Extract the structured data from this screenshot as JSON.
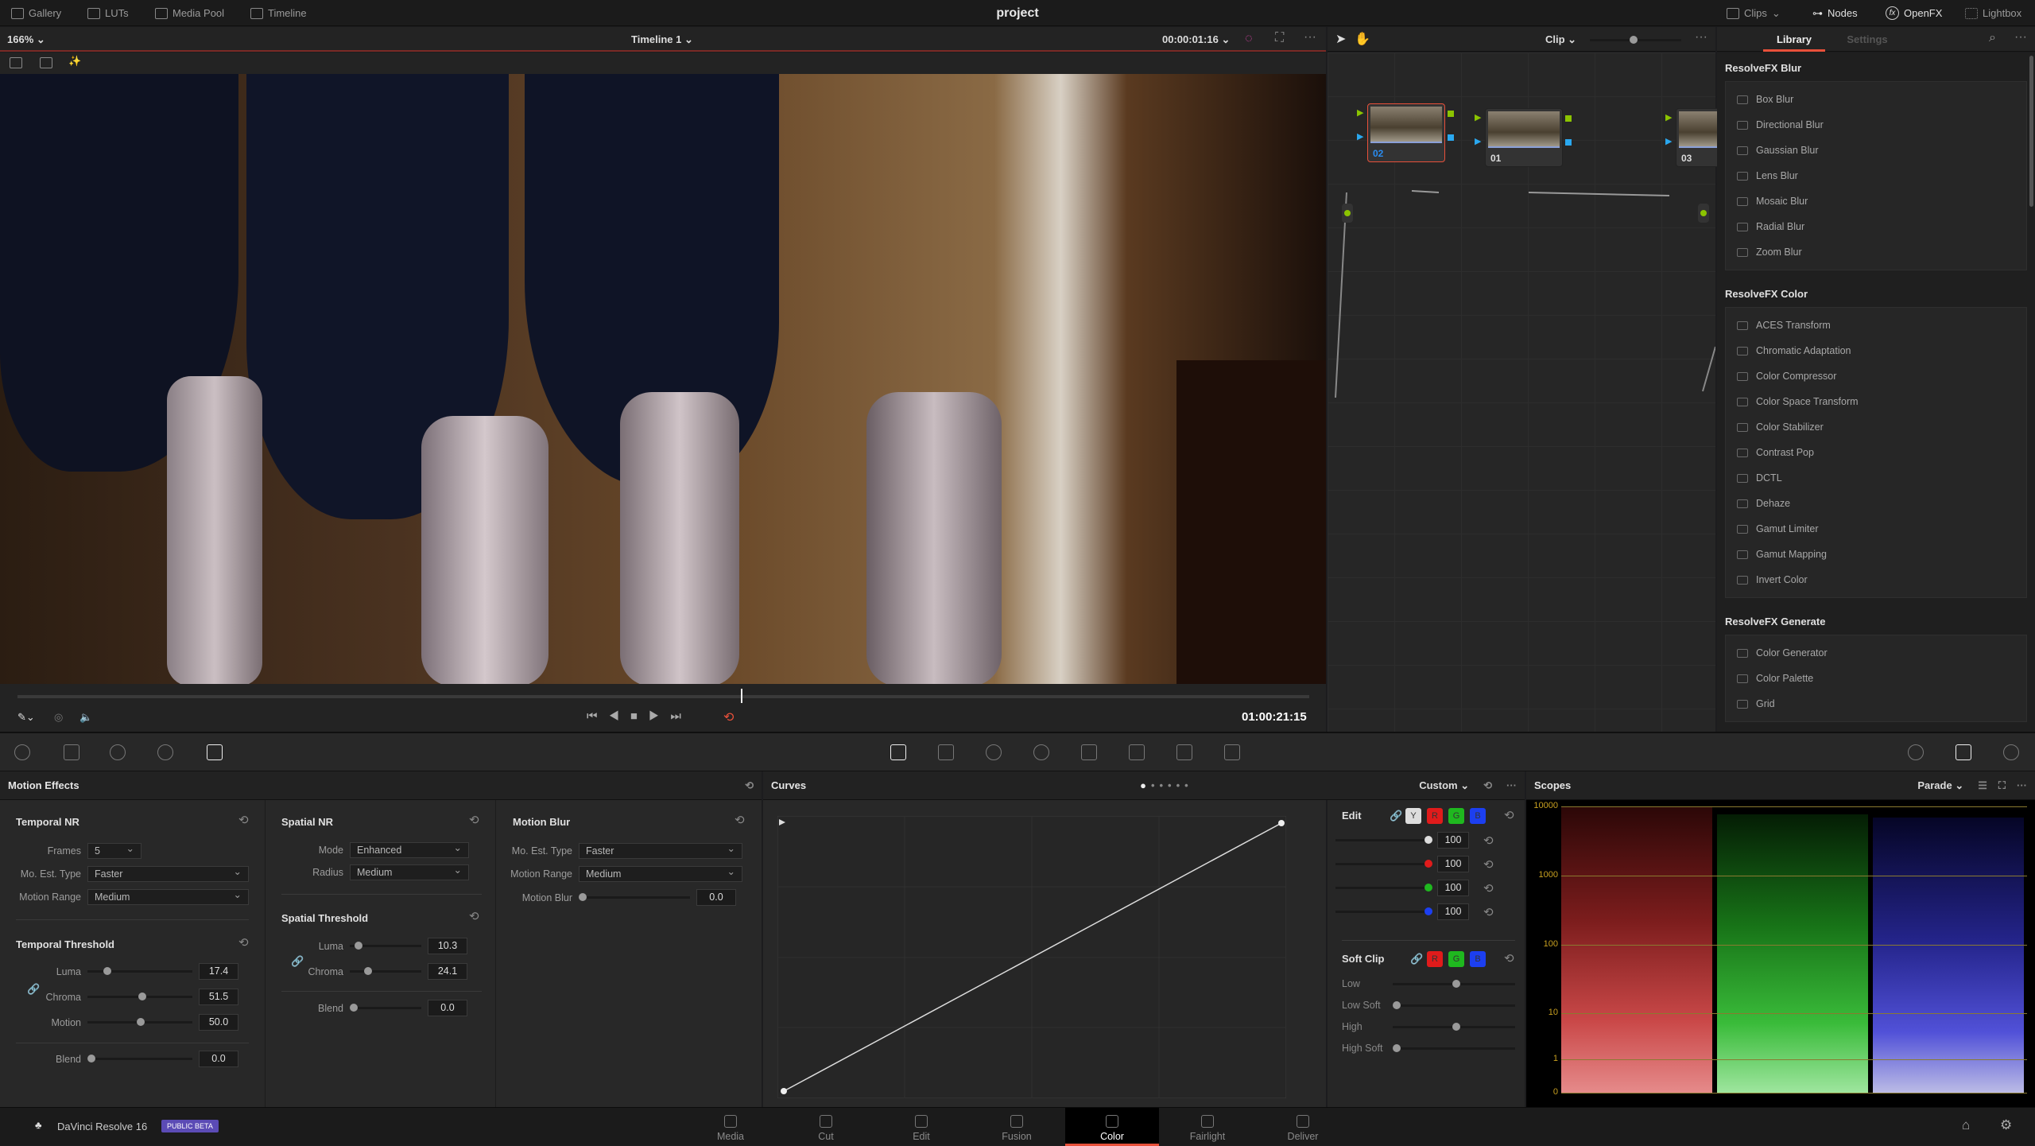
{
  "app": {
    "project_title": "project",
    "name": "DaVinci Resolve 16",
    "badge": "PUBLIC BETA"
  },
  "topbar": {
    "left": [
      "Gallery",
      "LUTs",
      "Media Pool",
      "Timeline"
    ],
    "right": [
      "Clips",
      "Nodes",
      "OpenFX",
      "Lightbox"
    ]
  },
  "viewer": {
    "zoom": "166%",
    "timeline": "Timeline 1",
    "timecode": "00:00:01:16",
    "playhead_timecode": "01:00:21:15",
    "playhead_position": 0.56
  },
  "nodes": {
    "mode": "Clip",
    "items": [
      {
        "id": "02",
        "selected": true
      },
      {
        "id": "01",
        "selected": false
      },
      {
        "id": "03",
        "selected": false
      }
    ]
  },
  "library": {
    "tabs": [
      "Library",
      "Settings"
    ],
    "active_tab": "Library",
    "groups": [
      {
        "title": "ResolveFX Blur",
        "items": [
          "Box Blur",
          "Directional Blur",
          "Gaussian Blur",
          "Lens Blur",
          "Mosaic Blur",
          "Radial Blur",
          "Zoom Blur"
        ]
      },
      {
        "title": "ResolveFX Color",
        "items": [
          "ACES Transform",
          "Chromatic Adaptation",
          "Color Compressor",
          "Color Space Transform",
          "Color Stabilizer",
          "Contrast Pop",
          "DCTL",
          "Dehaze",
          "Gamut Limiter",
          "Gamut Mapping",
          "Invert Color"
        ]
      },
      {
        "title": "ResolveFX Generate",
        "items": [
          "Color Generator",
          "Color Palette",
          "Grid"
        ]
      }
    ]
  },
  "motion": {
    "title": "Motion Effects",
    "temporal_nr": {
      "title": "Temporal NR",
      "frames_label": "Frames",
      "frames": "5",
      "est_label": "Mo. Est. Type",
      "est": "Faster",
      "range_label": "Motion Range",
      "range": "Medium"
    },
    "temporal_threshold": {
      "title": "Temporal Threshold",
      "luma_label": "Luma",
      "luma": "17.4",
      "chroma_label": "Chroma",
      "chroma": "51.5",
      "motion_label": "Motion",
      "motion": "50.0",
      "blend_label": "Blend",
      "blend": "0.0"
    },
    "spatial_nr": {
      "title": "Spatial NR",
      "mode_label": "Mode",
      "mode": "Enhanced",
      "radius_label": "Radius",
      "radius": "Medium"
    },
    "spatial_threshold": {
      "title": "Spatial Threshold",
      "luma_label": "Luma",
      "luma": "10.3",
      "chroma_label": "Chroma",
      "chroma": "24.1",
      "blend_label": "Blend",
      "blend": "0.0"
    },
    "motion_blur": {
      "title": "Motion Blur",
      "est_label": "Mo. Est. Type",
      "est": "Faster",
      "range_label": "Motion Range",
      "range": "Medium",
      "blur_label": "Motion Blur",
      "blur": "0.0"
    }
  },
  "curves": {
    "title": "Curves",
    "preset": "Custom",
    "edit_label": "Edit",
    "channels": [
      "Y",
      "R",
      "G",
      "B"
    ],
    "values": [
      "100",
      "100",
      "100",
      "100"
    ],
    "soft_clip_label": "Soft Clip",
    "soft_clip": [
      "Low",
      "Low Soft",
      "High",
      "High Soft"
    ]
  },
  "scopes": {
    "title": "Scopes",
    "mode": "Parade",
    "scale": [
      "10000",
      "1000",
      "100",
      "10",
      "1",
      "0"
    ]
  },
  "pages": [
    "Media",
    "Cut",
    "Edit",
    "Fusion",
    "Color",
    "Fairlight",
    "Deliver"
  ],
  "active_page": "Color",
  "colors": {
    "accent": "#e8503a",
    "badge": "#5b4bb5",
    "red": "#e01b1b",
    "green": "#1fb81f",
    "blue": "#1c3ff0"
  }
}
